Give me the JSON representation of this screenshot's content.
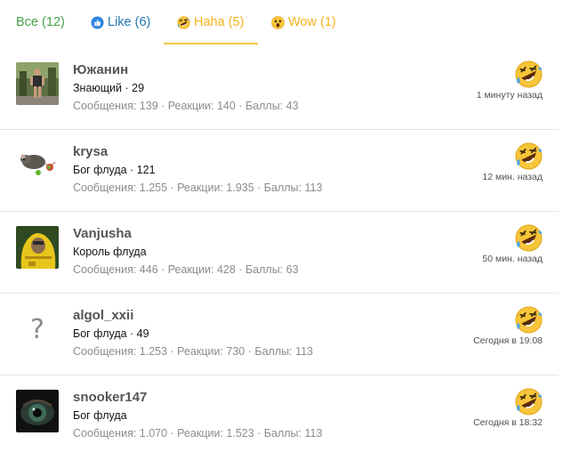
{
  "tabs": [
    {
      "label": "Все (12)",
      "color": "#47a34b"
    },
    {
      "label": "Like (6)",
      "color": "#2577b1",
      "icon": "like-icon"
    },
    {
      "label": "Haha (5)",
      "color": "#f5b21b",
      "icon": "haha-icon",
      "active": true
    },
    {
      "label": "Wow (1)",
      "color": "#f5b21b",
      "icon": "wow-icon"
    }
  ],
  "colors": {
    "accent": "#f7c948",
    "divider": "#e3e6ea",
    "username": "#555555",
    "stats": "#8c8c8c"
  },
  "users": [
    {
      "name": "Южанин",
      "title": "Знающий · 29",
      "stats": "Сообщения: 139 · Реакции: 140 · Баллы: 43",
      "time": "1 минуту назад",
      "reaction_icon": "haha-icon",
      "avatar_icon": "person-photo"
    },
    {
      "name": "krysa",
      "title": "Бог флуда · 121",
      "stats": "Сообщения: 1.255 · Реакции: 1.935 · Баллы: 113",
      "time": "12 мин. назад",
      "reaction_icon": "haha-icon",
      "avatar_icon": "rat-photo",
      "online": true
    },
    {
      "name": "Vanjusha",
      "title": "Король флуда",
      "stats": "Сообщения: 446 · Реакции: 428 · Баллы: 63",
      "time": "50 мин. назад",
      "reaction_icon": "haha-icon",
      "avatar_icon": "hazmat-photo"
    },
    {
      "name": "algol_xxii",
      "title": "Бог флуда · 49",
      "stats": "Сообщения: 1.253 · Реакции: 730 · Баллы: 113",
      "time": "Сегодня в 19:08",
      "reaction_icon": "haha-icon",
      "avatar_glyph": "?"
    },
    {
      "name": "snooker147",
      "title": "Бог флуда",
      "stats": "Сообщения: 1.070 · Реакции: 1.523 · Баллы: 113",
      "time": "Сегодня в 18:32",
      "reaction_icon": "haha-icon",
      "avatar_icon": "eye-photo"
    }
  ]
}
